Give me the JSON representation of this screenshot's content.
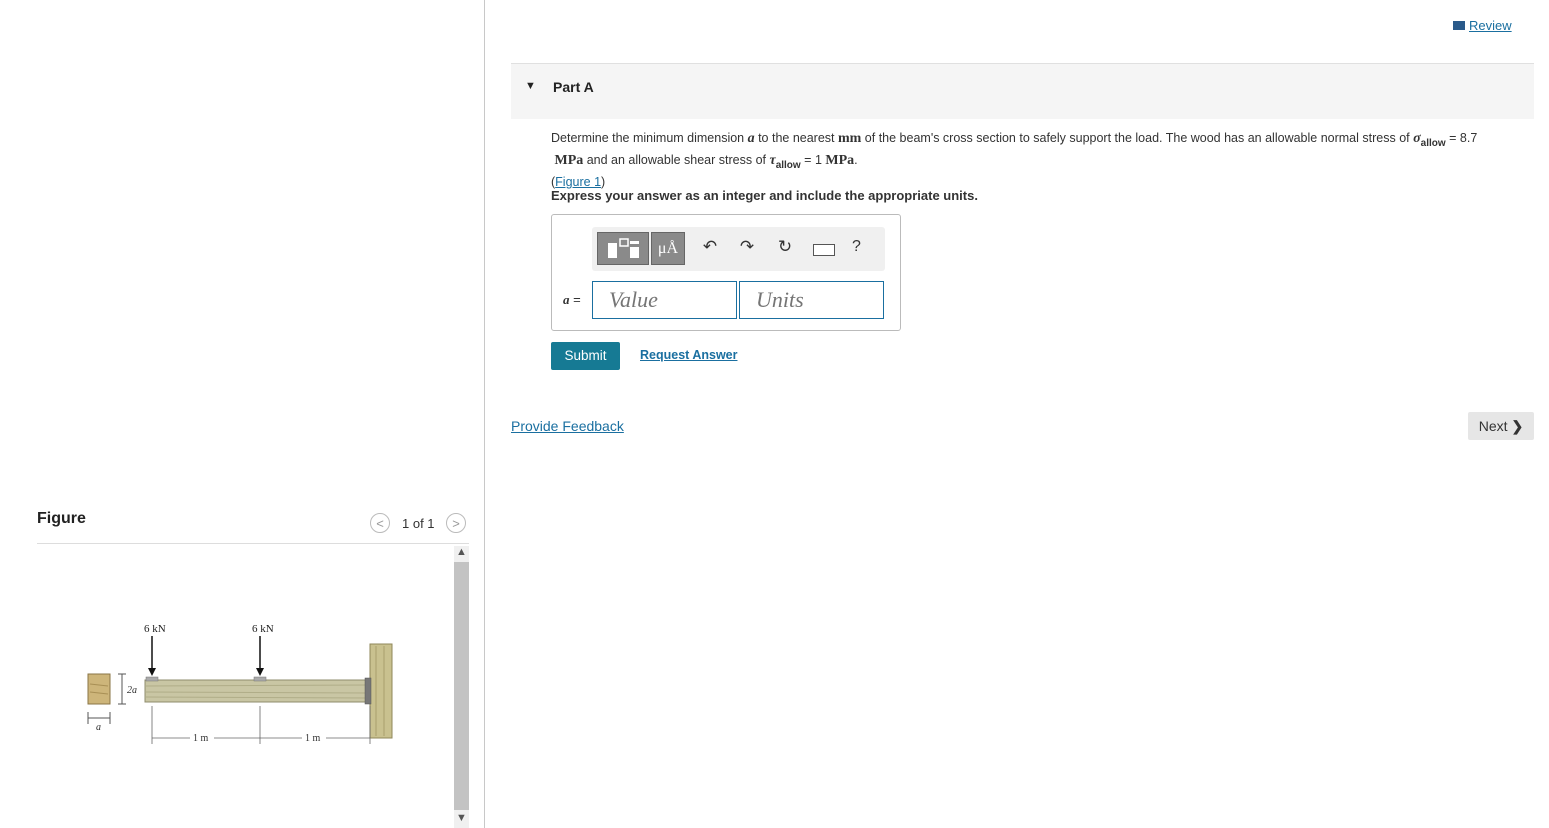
{
  "review": {
    "label": "Review",
    "icon": "book-icon"
  },
  "part": {
    "title": "Part A",
    "toggle_icon": "triangle-down-icon"
  },
  "question": {
    "text1": "Determine the minimum dimension ",
    "var_a": "a",
    "text2": " to the nearest ",
    "unit_mm": "mm",
    "text3": " of the beam's cross section to safely support the load. The wood has an allowable normal stress of ",
    "sigma": "σ",
    "allow_sub": "allow",
    "sigma_value": " = 8.7",
    "unit_mpa": "MPa",
    "text4": " and an allowable shear stress of ",
    "tau": "τ",
    "tau_value": " = 1 ",
    "text5": ".",
    "figure_link": "Figure 1",
    "paren_open": "(",
    "paren_close": ")"
  },
  "instruction": "Express your answer as an integer and include the appropriate units.",
  "answer": {
    "var_label": "a",
    "eq": " =",
    "value_placeholder": "Value",
    "units_placeholder": "Units",
    "units_tool": "μÅ",
    "help": "?"
  },
  "actions": {
    "submit": "Submit",
    "request_answer": "Request Answer",
    "provide_feedback": "Provide Feedback",
    "next": "Next",
    "next_icon": "❯"
  },
  "figure": {
    "heading": "Figure",
    "counter": "1 of 1",
    "prev": "<",
    "next": ">",
    "load1": "6 kN",
    "load2": "6 kN",
    "span1": "1 m",
    "span2": "1 m",
    "height_label": "2a",
    "width_label": "a"
  },
  "colors": {
    "accent": "#167a94",
    "link": "#1a6fa0"
  }
}
